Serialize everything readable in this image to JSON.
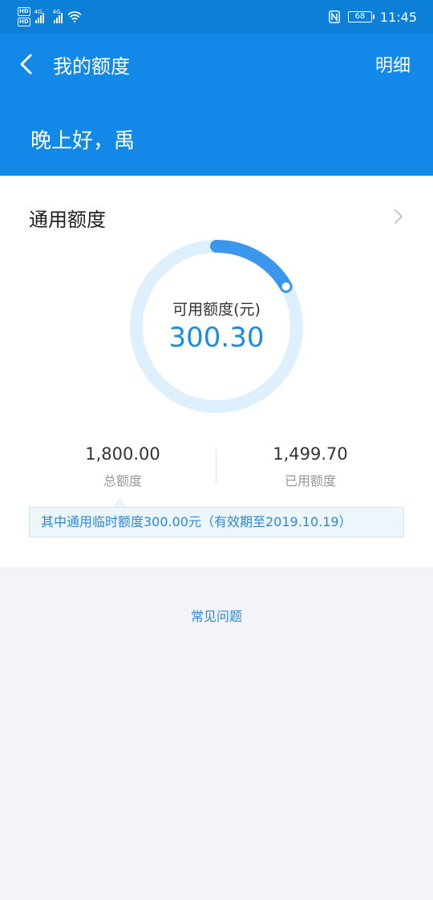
{
  "status_bar": {
    "hd1": "HD",
    "hd2": "HD",
    "net1": "4G",
    "net2": "4G",
    "battery": "68",
    "time": "11:45"
  },
  "header": {
    "title": "我的额度",
    "detail_label": "明细",
    "greeting": "晚上好，禹"
  },
  "card": {
    "title": "通用额度",
    "ring": {
      "label": "可用额度(元)",
      "value": "300.30",
      "available_fraction": 0.167,
      "track_color": "#dff0fd",
      "fill_color": "#3b96ee"
    },
    "total": {
      "value": "1,800.00",
      "label": "总额度"
    },
    "used": {
      "value": "1,499.70",
      "label": "已用额度"
    },
    "notice": "其中通用临时额度300.00元（有效期至2019.10.19）"
  },
  "faq_label": "常见问题",
  "colors": {
    "primary": "#1289e8",
    "status_bar": "#0c7fd9",
    "link": "#2b88d8"
  }
}
